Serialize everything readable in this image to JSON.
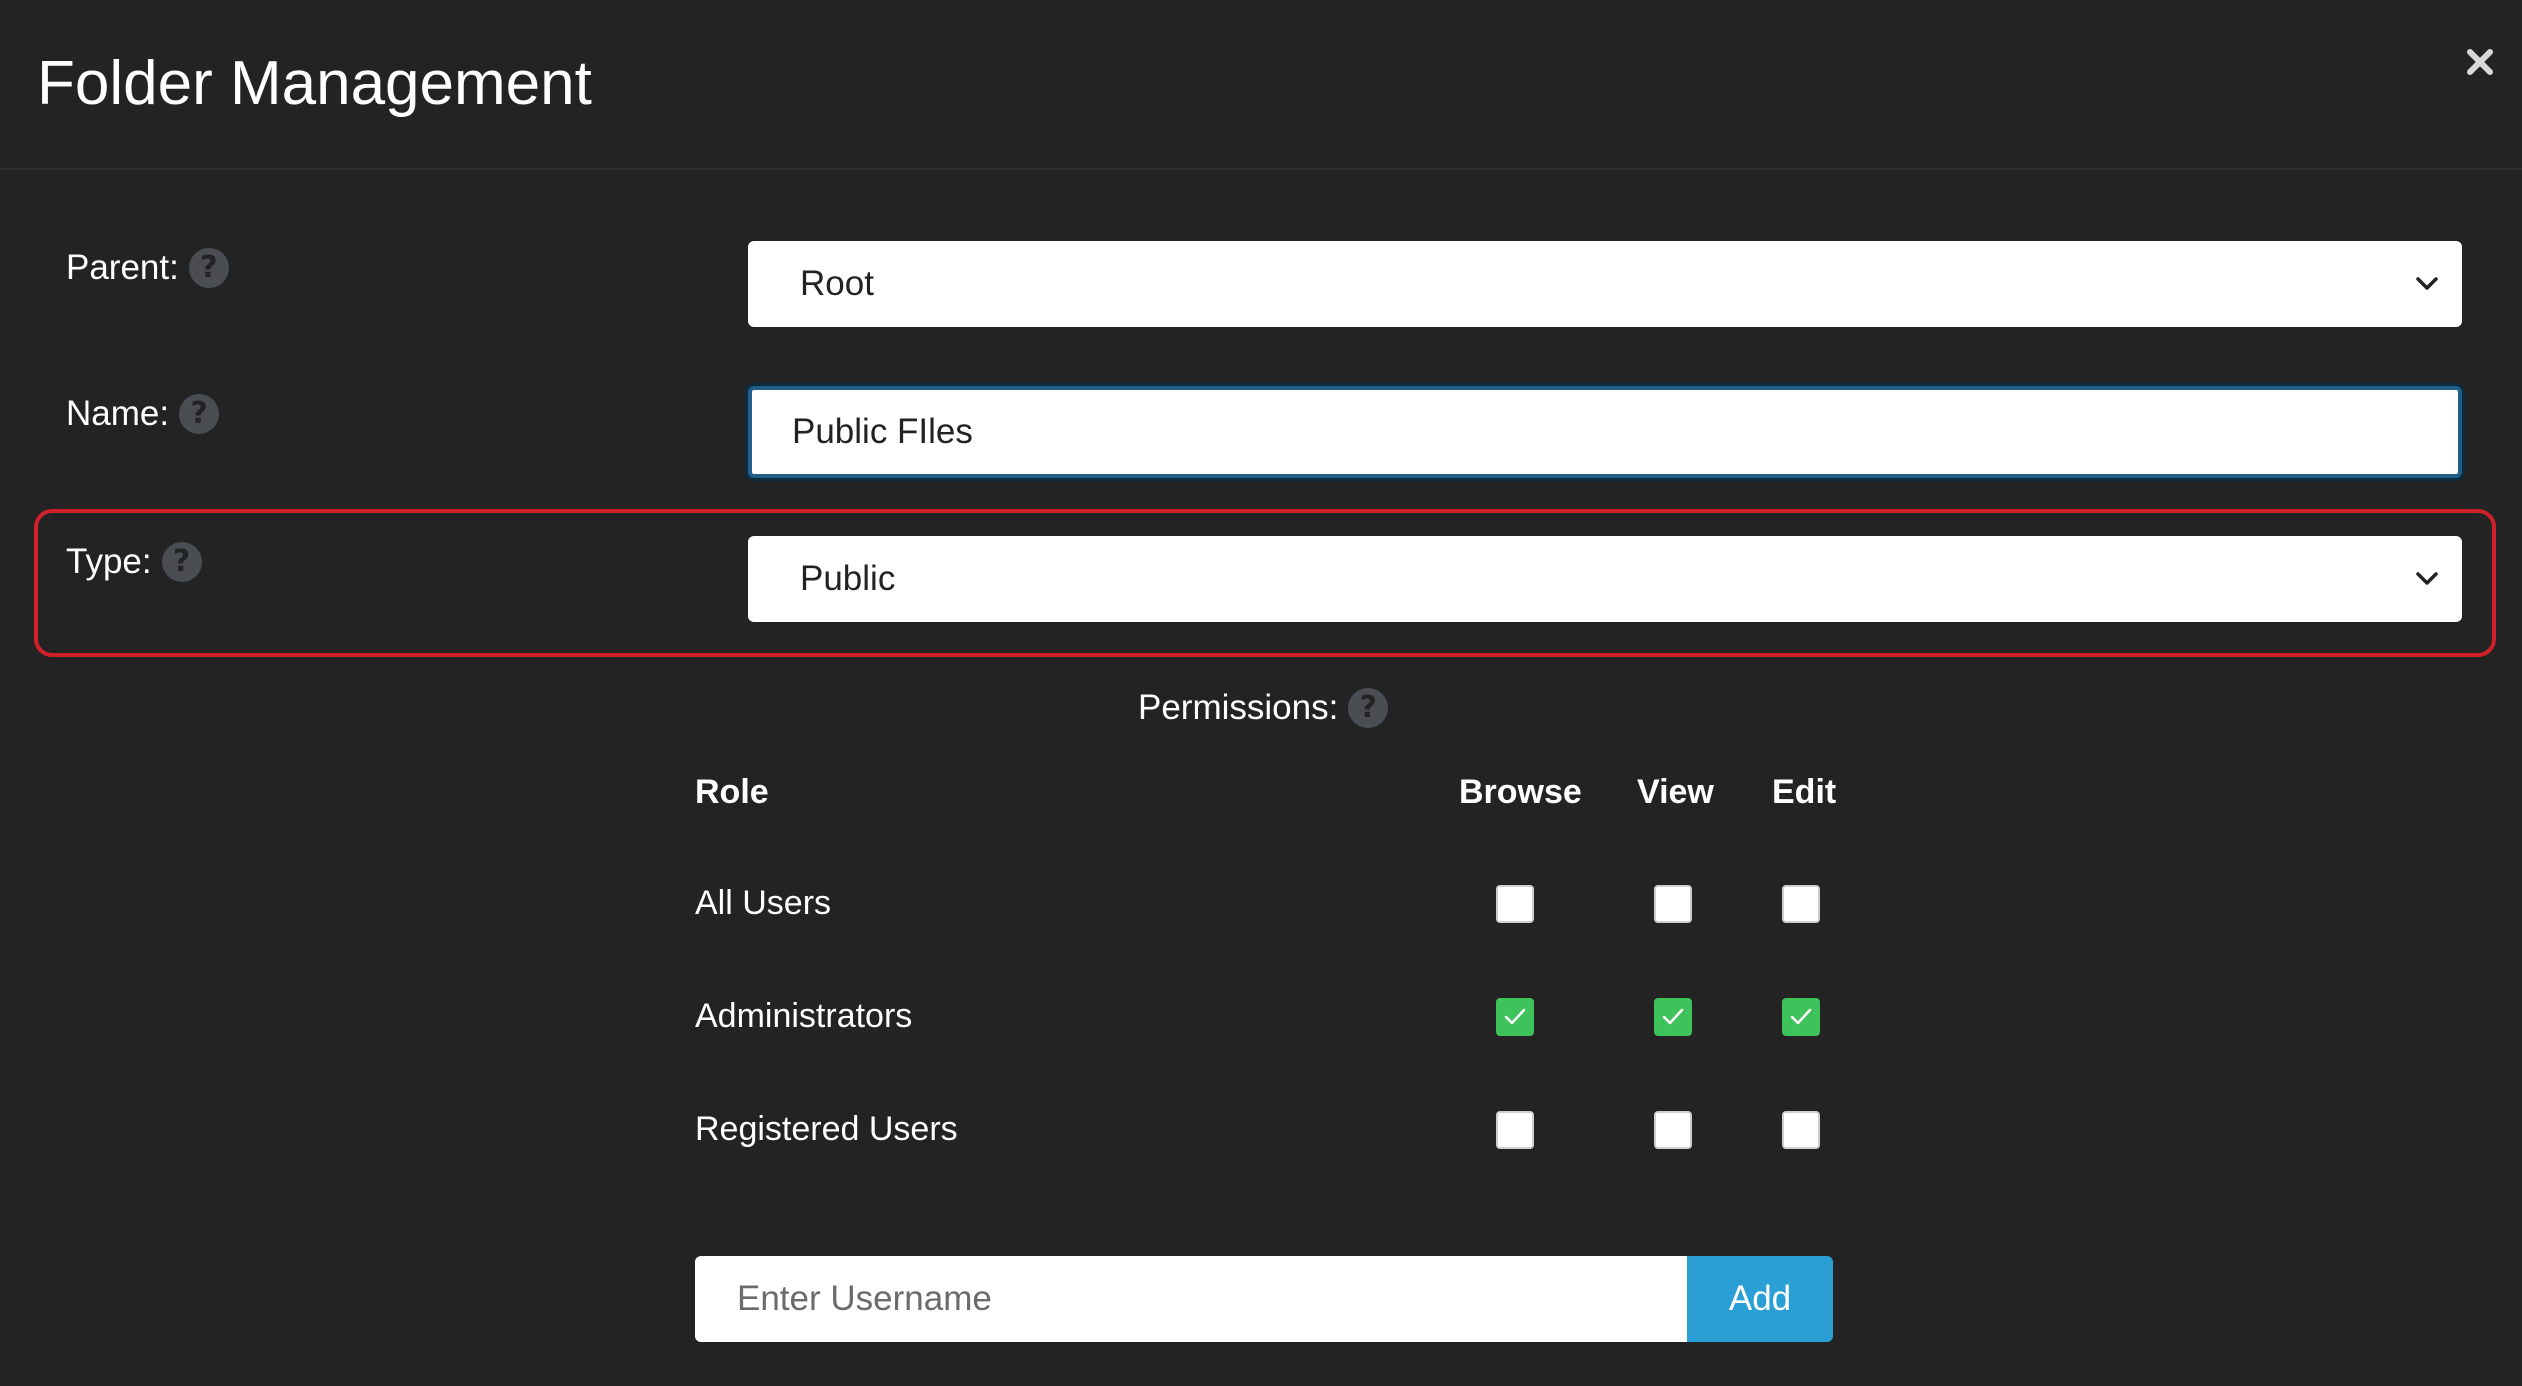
{
  "modal": {
    "title": "Folder Management",
    "close_icon": "close-icon"
  },
  "form": {
    "parent": {
      "label": "Parent:",
      "value": "Root"
    },
    "name": {
      "label": "Name:",
      "value": "Public FIles"
    },
    "type": {
      "label": "Type:",
      "value": "Public"
    }
  },
  "permissions": {
    "label": "Permissions:",
    "columns": {
      "role": "Role",
      "browse": "Browse",
      "view": "View",
      "edit": "Edit"
    },
    "rows": [
      {
        "role": "All Users",
        "browse": false,
        "view": false,
        "edit": false
      },
      {
        "role": "Administrators",
        "browse": true,
        "view": true,
        "edit": true
      },
      {
        "role": "Registered Users",
        "browse": false,
        "view": false,
        "edit": false
      }
    ]
  },
  "add_user": {
    "placeholder": "Enter Username",
    "button_label": "Add"
  },
  "colors": {
    "background": "#232323",
    "accent": "#2a9fd6",
    "checked": "#3ec25a",
    "highlight": "#d0202a"
  }
}
